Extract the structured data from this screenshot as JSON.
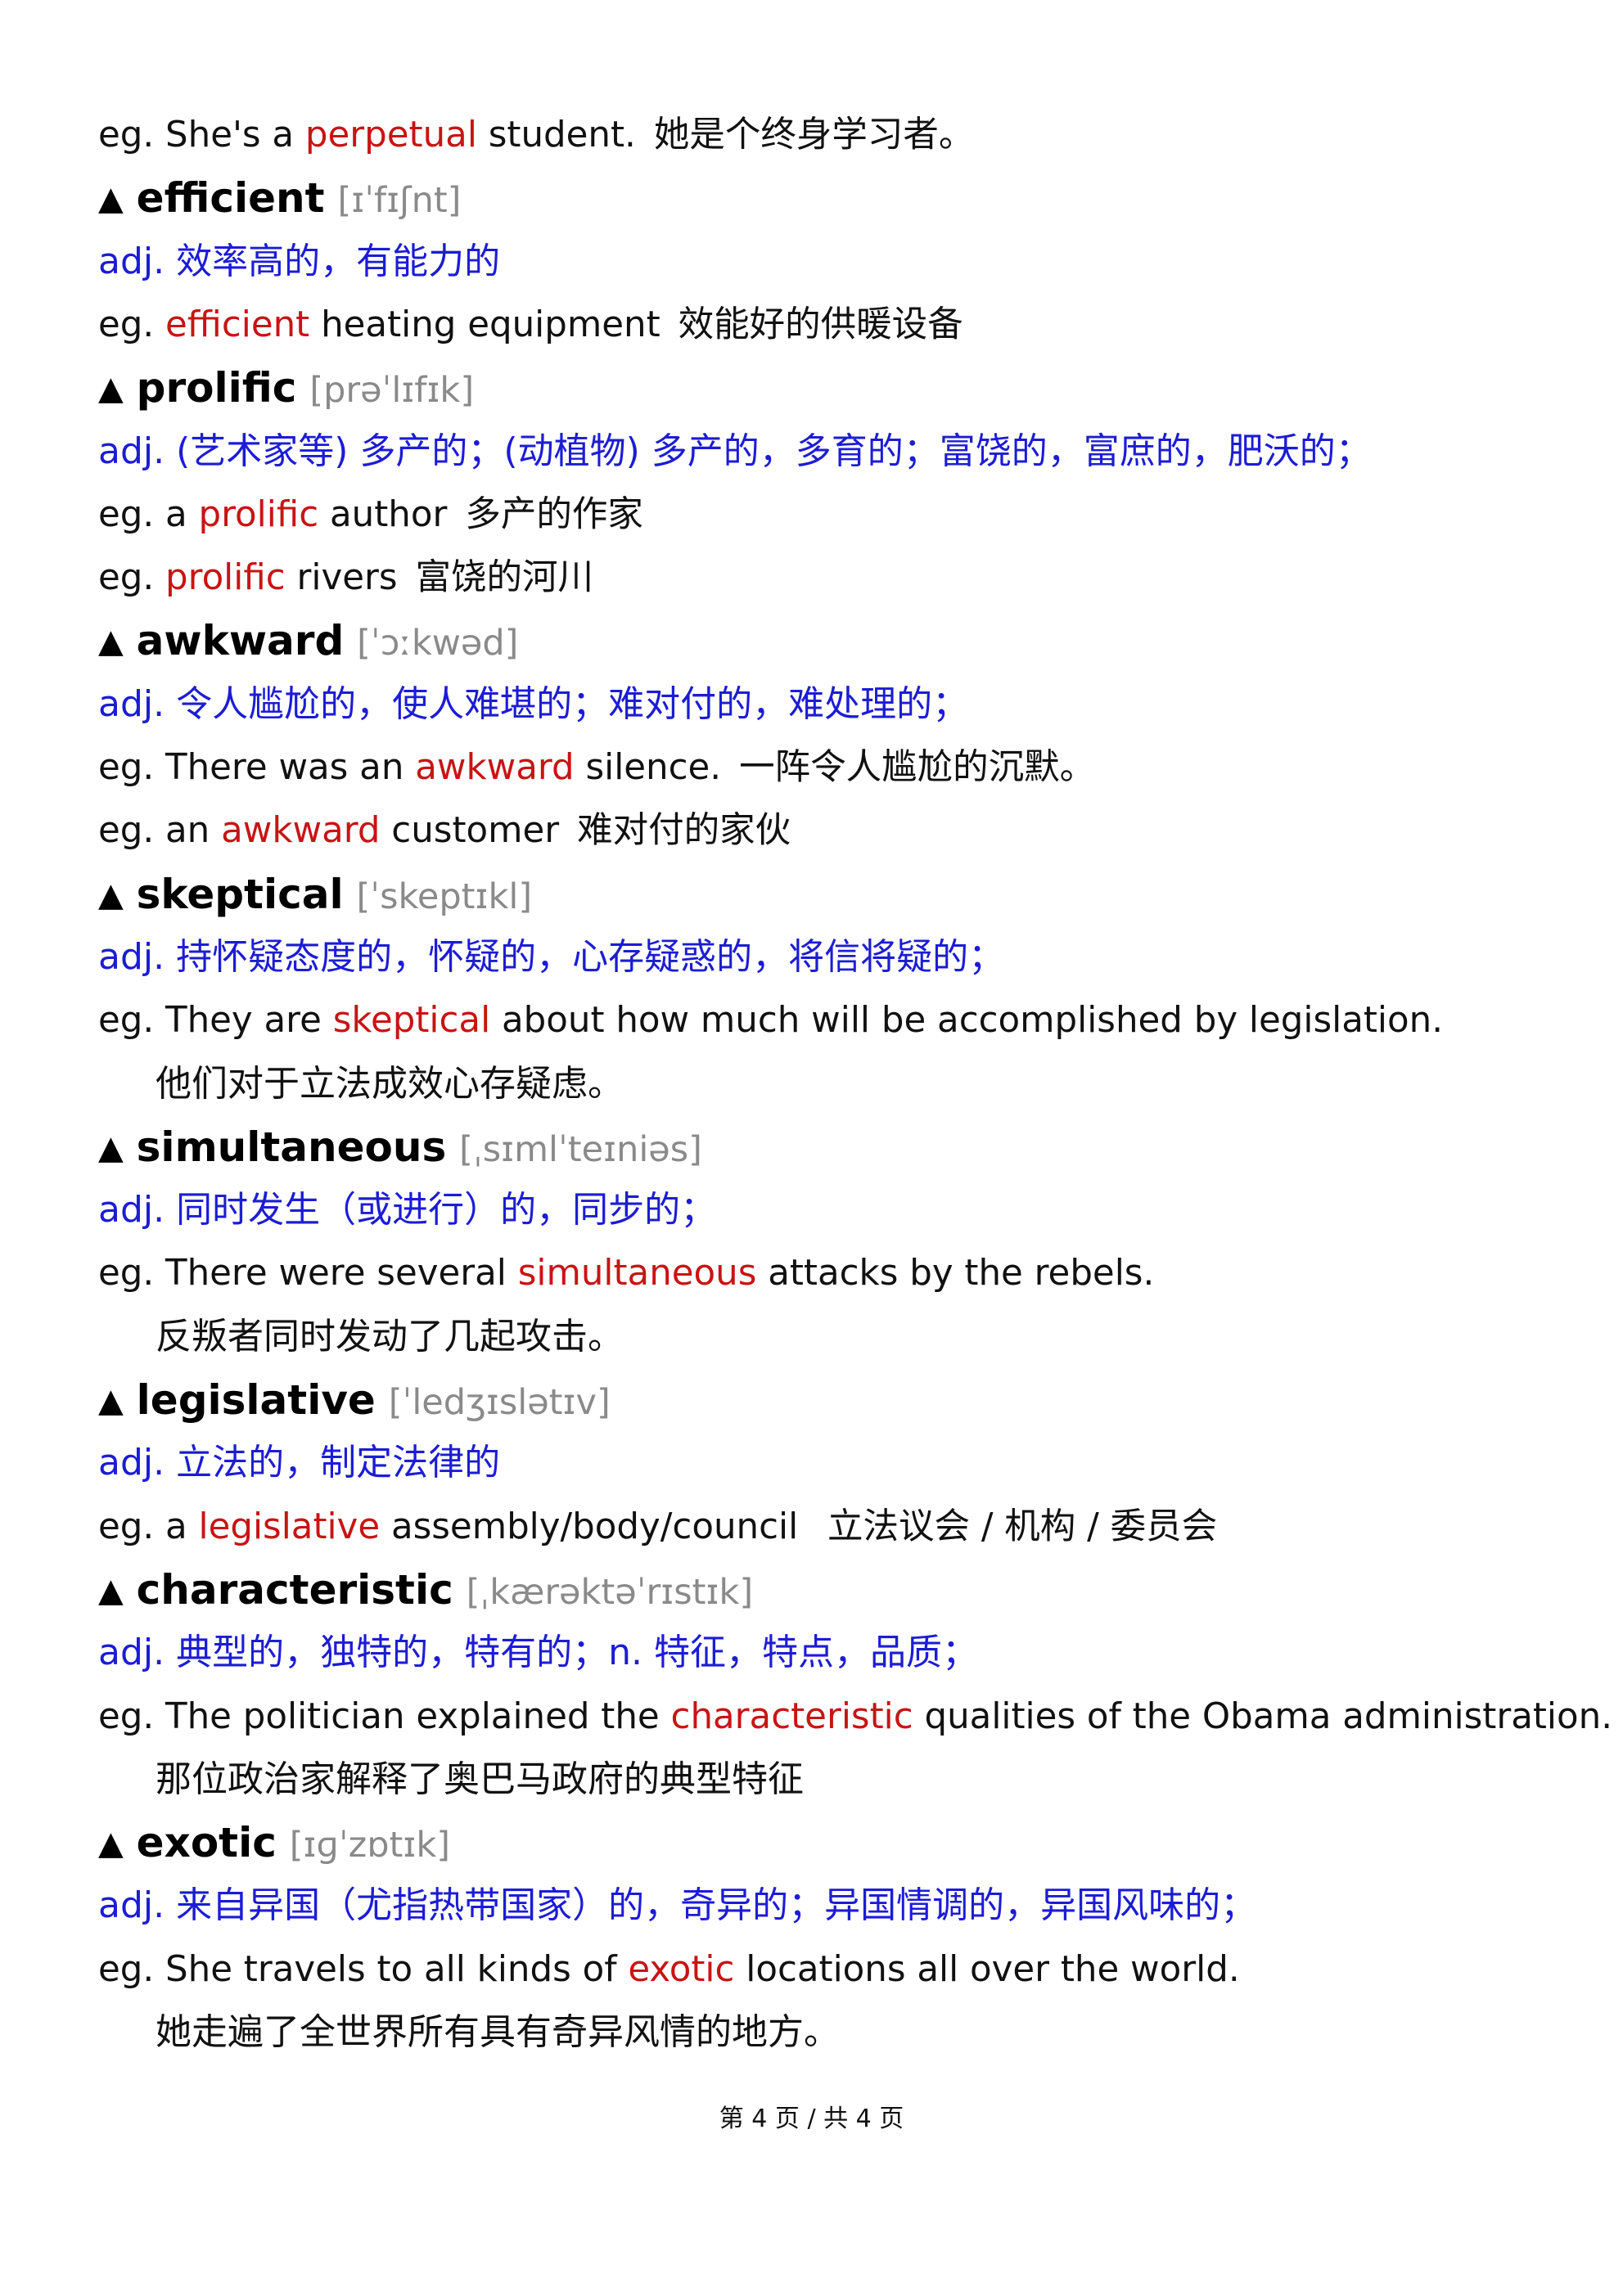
{
  "footer": "第 4 页 / 共 4 页",
  "entries": [
    {
      "kind": "ex",
      "pre": "eg. She's a ",
      "hl": "perpetual",
      "post": " student.",
      "zh": "她是个终身学习者。"
    },
    {
      "kind": "head",
      "tri": "▲",
      "word": "efficient",
      "ipa": "[ɪˈfɪʃnt]"
    },
    {
      "kind": "def",
      "text": "adj.  效率高的，有能力的"
    },
    {
      "kind": "ex",
      "pre": "eg. ",
      "hl": "efficient",
      "post": " heating equipment",
      "zh": "效能好的供暖设备"
    },
    {
      "kind": "head",
      "tri": "▲",
      "word": "prolific",
      "ipa": "[prəˈlɪfɪk]"
    },
    {
      "kind": "def",
      "text": "adj.   (艺术家等) 多产的；(动植物) 多产的，多育的；富饶的，富庶的，肥沃的；"
    },
    {
      "kind": "ex",
      "pre": "eg. a ",
      "hl": "prolific",
      "post": " author",
      "zh": "多产的作家"
    },
    {
      "kind": "ex",
      "pre": "eg. ",
      "hl": "prolific",
      "post": " rivers",
      "zh": "富饶的河川"
    },
    {
      "kind": "head",
      "tri": "▲",
      "word": "awkward",
      "ipa": "[ˈɔːkwəd]"
    },
    {
      "kind": "def",
      "text": "adj.  令人尴尬的，使人难堪的；难对付的，难处理的；"
    },
    {
      "kind": "ex",
      "pre": "eg. There was an ",
      "hl": "awkward",
      "post": " silence.",
      "zh": "一阵令人尴尬的沉默。"
    },
    {
      "kind": "ex",
      "pre": "eg. an ",
      "hl": "awkward",
      "post": " customer",
      "zh": "难对付的家伙"
    },
    {
      "kind": "head",
      "tri": "▲",
      "word": "skeptical",
      "ipa": "[ˈskeptɪkl]"
    },
    {
      "kind": "def",
      "text": "adj.  持怀疑态度的，怀疑的，心存疑惑的，将信将疑的；"
    },
    {
      "kind": "ex",
      "pre": "eg. They are ",
      "hl": "skeptical",
      "post": " about how much will be accomplished by legislation.",
      "zh": ""
    },
    {
      "kind": "zh",
      "text": "他们对于立法成效心存疑虑。"
    },
    {
      "kind": "head",
      "tri": "▲",
      "word": "simultaneous",
      "ipa": "[ˌsɪmlˈteɪniəs]"
    },
    {
      "kind": "def",
      "text": "adj.  同时发生（或进行）的，同步的；"
    },
    {
      "kind": "ex",
      "pre": "eg. There were several ",
      "hl": "simultaneous",
      "post": " attacks by the rebels.",
      "zh": ""
    },
    {
      "kind": "zh",
      "text": "反叛者同时发动了几起攻击。"
    },
    {
      "kind": "head",
      "tri": "▲",
      "word": "legislative",
      "ipa": "[ˈledʒɪslətɪv]"
    },
    {
      "kind": "def",
      "text": "adj.  立法的，制定法律的"
    },
    {
      "kind": "ex",
      "pre": "eg. a ",
      "hl": "legislative",
      "post": " assembly/body/council",
      "zh": " 立法议会 / 机构 / 委员会"
    },
    {
      "kind": "head",
      "tri": "▲",
      "word": "characteristic",
      "ipa": "[ˌkærəktəˈrɪstɪk]"
    },
    {
      "kind": "def",
      "text": "adj.  典型的，独特的，特有的；n.  特征，特点，品质；"
    },
    {
      "kind": "ex",
      "pre": "eg. The politician explained the ",
      "hl": "characteristic",
      "post": " qualities of the Obama administration.",
      "zh": ""
    },
    {
      "kind": "zh",
      "text": "那位政治家解释了奥巴马政府的典型特征"
    },
    {
      "kind": "head",
      "tri": "▲",
      "word": "exotic",
      "ipa": "[ɪɡˈzɒtɪk]"
    },
    {
      "kind": "def",
      "text": "adj.  来自异国（尤指热带国家）的，奇异的；异国情调的，异国风味的；"
    },
    {
      "kind": "ex",
      "pre": "eg. She travels to all kinds of ",
      "hl": "exotic",
      "post": " locations all over the world.",
      "zh": ""
    },
    {
      "kind": "zh",
      "text": "她走遍了全世界所有具有奇异风情的地方。"
    }
  ]
}
